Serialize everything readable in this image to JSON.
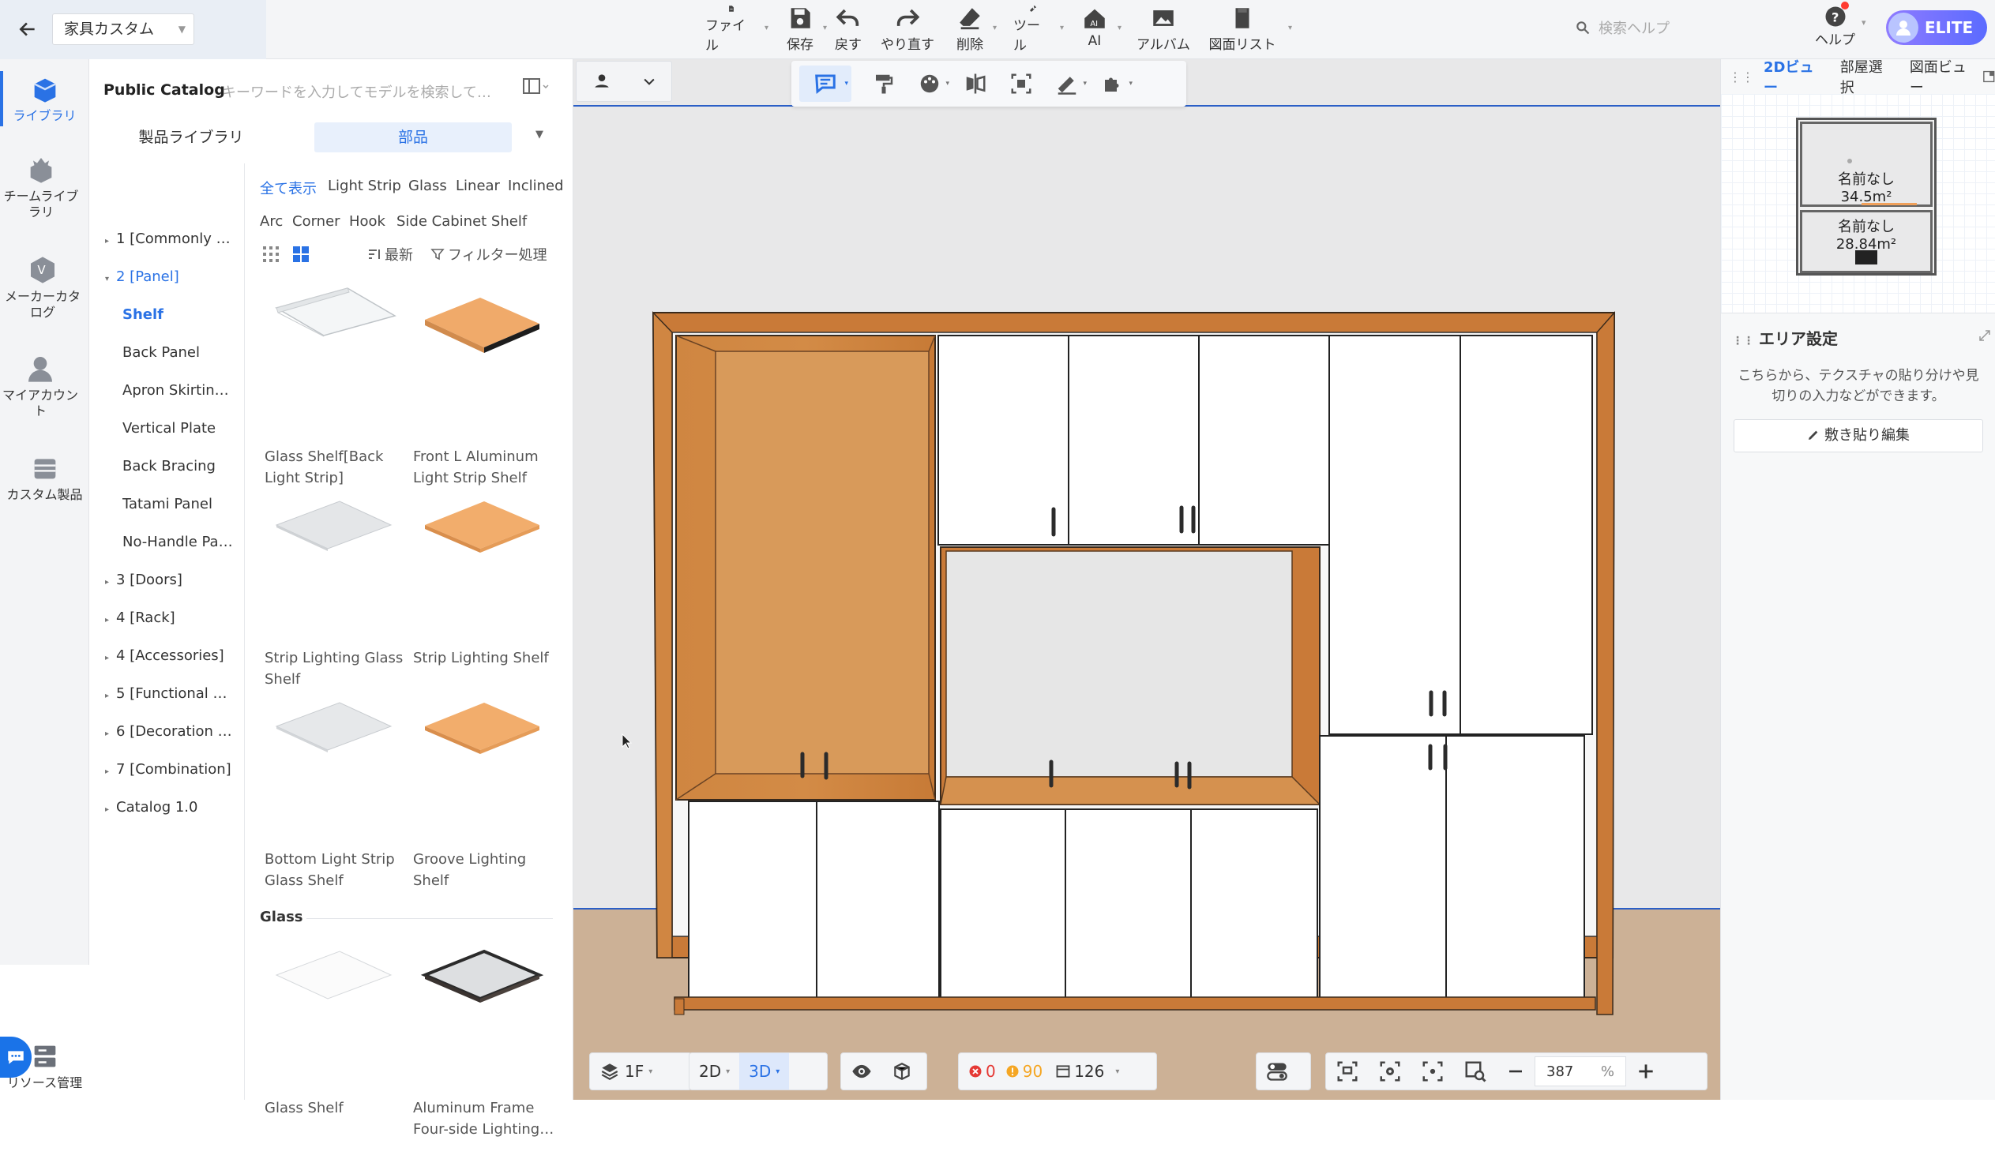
{
  "topbar": {
    "doc_name": "家具カスタム",
    "buttons": [
      {
        "label": "ファイル",
        "icon": "file-icon"
      },
      {
        "label": "保存",
        "icon": "save-icon"
      },
      {
        "label": "戻す",
        "icon": "undo-icon"
      },
      {
        "label": "やり直す",
        "icon": "redo-icon"
      },
      {
        "label": "削除",
        "icon": "eraser-icon"
      },
      {
        "label": "ツール",
        "icon": "wrench-icon"
      },
      {
        "label": "AI",
        "icon": "ai-house-icon"
      },
      {
        "label": "アルバム",
        "icon": "album-icon"
      },
      {
        "label": "図面リスト",
        "icon": "drawing-list-icon"
      }
    ],
    "search_placeholder": "検索ヘルプ",
    "help_label": "ヘルプ",
    "plan_badge": "ELITE"
  },
  "rail": {
    "items": [
      {
        "label": "ライブラリ",
        "icon": "library-icon",
        "active": true
      },
      {
        "label": "チームライブラリ",
        "icon": "team-library-icon"
      },
      {
        "label": "メーカーカタログ",
        "icon": "maker-catalog-icon"
      },
      {
        "label": "マイアカウント",
        "icon": "account-icon"
      },
      {
        "label": "カスタム製品",
        "icon": "custom-product-icon"
      }
    ],
    "bottom_label": "リソース管理"
  },
  "library": {
    "title": "Public Catalog",
    "search_placeholder": "キーワードを入力してモデルを検索して…",
    "tab_products": "製品ライブラリ",
    "tab_parts": "部品",
    "tree": [
      {
        "label": "1 [Commonly …",
        "arrow": "▸"
      },
      {
        "label": "2 [Panel]",
        "arrow": "▾"
      },
      {
        "label": "Shelf",
        "arrow": ""
      },
      {
        "label": "Back Panel",
        "arrow": ""
      },
      {
        "label": "Apron Skirtin…",
        "arrow": ""
      },
      {
        "label": "Vertical Plate",
        "arrow": ""
      },
      {
        "label": "Back Bracing",
        "arrow": ""
      },
      {
        "label": "Tatami Panel",
        "arrow": ""
      },
      {
        "label": "No-Handle Pa…",
        "arrow": ""
      },
      {
        "label": "3 [Doors]",
        "arrow": "▸"
      },
      {
        "label": "4 [Rack]",
        "arrow": "▸"
      },
      {
        "label": "4 [Accessories]",
        "arrow": "▸"
      },
      {
        "label": "5 [Functional …",
        "arrow": "▸"
      },
      {
        "label": "6 [Decoration …",
        "arrow": "▸"
      },
      {
        "label": "7 [Combination]",
        "arrow": "▸"
      },
      {
        "label": "Catalog 1.0",
        "arrow": "▸"
      }
    ],
    "filters_row1": [
      "全て表示",
      "Light Strip",
      "Glass",
      "Linear",
      "Inclined"
    ],
    "filters_row2": [
      "Arc",
      "Corner",
      "Hook",
      "Side Cabinet Shelf"
    ],
    "sort_label": "最新",
    "filter_label": "フィルター処理",
    "products": [
      {
        "name": "Glass Shelf[Back Light Strip]"
      },
      {
        "name": "Front L Aluminum Light Strip Shelf"
      },
      {
        "name": "Strip Lighting Glass Shelf"
      },
      {
        "name": "Strip Lighting Shelf"
      },
      {
        "name": "Bottom Light Strip Glass Shelf"
      },
      {
        "name": "Groove Lighting Shelf"
      }
    ],
    "section_glass": "Glass",
    "glass_products": [
      {
        "name": "Glass Shelf"
      },
      {
        "name": "Aluminum Frame Four-side Lighting…"
      }
    ]
  },
  "viewport": {
    "floor_label": "1F",
    "view_2d": "2D",
    "view_3d": "3D",
    "errors": "0",
    "warnings": "90",
    "items": "126",
    "zoom": "387",
    "zoom_unit": "%"
  },
  "right_panel": {
    "tabs": [
      "2Dビュー",
      "部屋選択",
      "図面ビュー"
    ],
    "rooms": [
      {
        "name": "名前なし",
        "area": "34.5m²"
      },
      {
        "name": "名前なし",
        "area": "28.84m²"
      }
    ],
    "area_title": "エリア設定",
    "area_desc": "こちらから、テクスチャの貼り分けや見切りの入力などができます。",
    "area_button": "敷き貼り編集"
  },
  "colors": {
    "accent": "#2a72e5",
    "wood": "#c97a38",
    "error": "#e53935",
    "warning": "#f5a623"
  }
}
